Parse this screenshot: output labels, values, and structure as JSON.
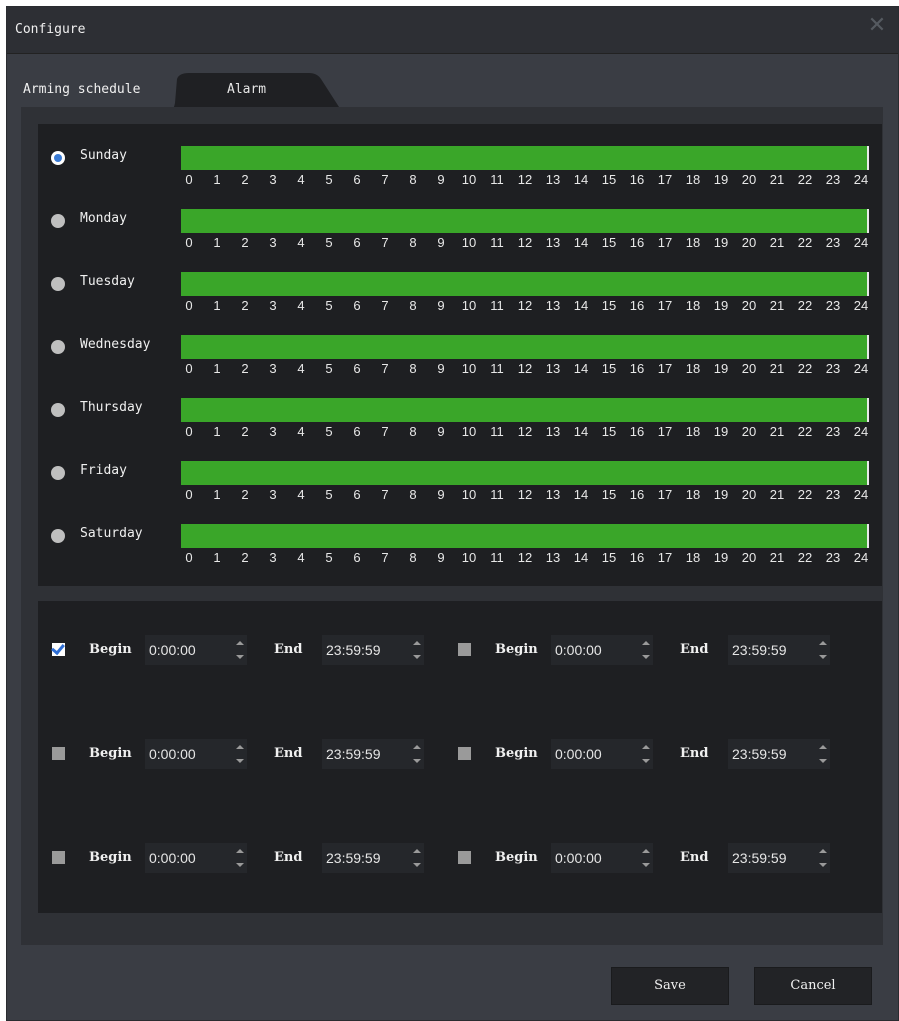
{
  "window": {
    "title": "Configure",
    "close_icon": "close-icon"
  },
  "tabs": [
    {
      "label": "Arming schedule",
      "active": true
    },
    {
      "label": "Alarm",
      "active": false
    }
  ],
  "days": [
    {
      "name": "Sunday",
      "selected": true,
      "armed_from": 0,
      "armed_to": 24
    },
    {
      "name": "Monday",
      "selected": false,
      "armed_from": 0,
      "armed_to": 24
    },
    {
      "name": "Tuesday",
      "selected": false,
      "armed_from": 0,
      "armed_to": 24
    },
    {
      "name": "Wednesday",
      "selected": false,
      "armed_from": 0,
      "armed_to": 24
    },
    {
      "name": "Thursday",
      "selected": false,
      "armed_from": 0,
      "armed_to": 24
    },
    {
      "name": "Friday",
      "selected": false,
      "armed_from": 0,
      "armed_to": 24
    },
    {
      "name": "Saturday",
      "selected": false,
      "armed_from": 0,
      "armed_to": 24
    }
  ],
  "hour_ticks": [
    "0",
    "1",
    "2",
    "3",
    "4",
    "5",
    "6",
    "7",
    "8",
    "9",
    "10",
    "11",
    "12",
    "13",
    "14",
    "15",
    "16",
    "17",
    "18",
    "19",
    "20",
    "21",
    "22",
    "23",
    "24"
  ],
  "bar_color": "#3aa629",
  "periods": [
    {
      "checked": true,
      "begin_label": "Begin",
      "begin": "0:00:00",
      "end_label": "End",
      "end": "23:59:59"
    },
    {
      "checked": false,
      "begin_label": "Begin",
      "begin": "0:00:00",
      "end_label": "End",
      "end": "23:59:59"
    },
    {
      "checked": false,
      "begin_label": "Begin",
      "begin": "0:00:00",
      "end_label": "End",
      "end": "23:59:59"
    },
    {
      "checked": false,
      "begin_label": "Begin",
      "begin": "0:00:00",
      "end_label": "End",
      "end": "23:59:59"
    },
    {
      "checked": false,
      "begin_label": "Begin",
      "begin": "0:00:00",
      "end_label": "End",
      "end": "23:59:59"
    },
    {
      "checked": false,
      "begin_label": "Begin",
      "begin": "0:00:00",
      "end_label": "End",
      "end": "23:59:59"
    }
  ],
  "buttons": {
    "save": "Save",
    "cancel": "Cancel"
  }
}
